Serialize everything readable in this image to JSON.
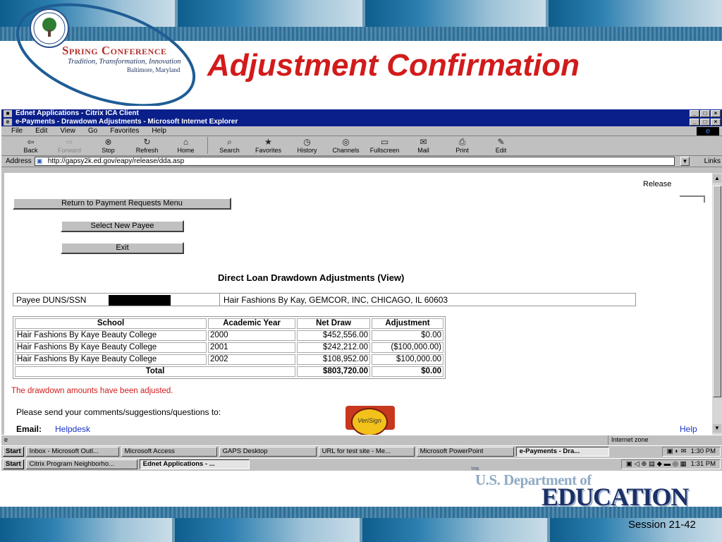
{
  "slide": {
    "conference_name": "Spring Conference",
    "conference_tagline": "Tradition, Transformation, Innovation",
    "conference_location": "Baltimore, Maryland",
    "title": "Adjustment Confirmation",
    "footer_logo_the": "THE",
    "footer_logo_line1": "U.S. Department of",
    "footer_logo_line2": "EDUCATION",
    "session": "Session 21-42"
  },
  "citrix_window": {
    "title": "Ednet Applications - Citrix ICA Client"
  },
  "ie_window": {
    "title": "e-Payments - Drawdown Adjustments - Microsoft Internet Explorer"
  },
  "window_buttons": {
    "minimize": "_",
    "maximize": "□",
    "close": "×"
  },
  "menu": [
    "File",
    "Edit",
    "View",
    "Go",
    "Favorites",
    "Help"
  ],
  "toolbar": [
    {
      "label": "Back",
      "icon": "back-arrow-icon",
      "glyph": "⇦"
    },
    {
      "label": "Forward",
      "icon": "forward-arrow-icon",
      "glyph": "⇨"
    },
    {
      "label": "Stop",
      "icon": "stop-icon",
      "glyph": "⊗"
    },
    {
      "label": "Refresh",
      "icon": "refresh-icon",
      "glyph": "↻"
    },
    {
      "label": "Home",
      "icon": "home-icon",
      "glyph": "⌂"
    },
    {
      "label": "Search",
      "icon": "search-icon",
      "glyph": "⌕"
    },
    {
      "label": "Favorites",
      "icon": "favorites-icon",
      "glyph": "★"
    },
    {
      "label": "History",
      "icon": "history-icon",
      "glyph": "◷"
    },
    {
      "label": "Channels",
      "icon": "channels-icon",
      "glyph": "◎"
    },
    {
      "label": "Fullscreen",
      "icon": "fullscreen-icon",
      "glyph": "▭"
    },
    {
      "label": "Mail",
      "icon": "mail-icon",
      "glyph": "✉"
    },
    {
      "label": "Print",
      "icon": "print-icon",
      "glyph": "⎙"
    },
    {
      "label": "Edit",
      "icon": "edit-icon",
      "glyph": "✎"
    }
  ],
  "address_bar": {
    "label": "Address",
    "url": "http://gapsy2k.ed.gov/eapy/release/dda.asp",
    "links_label": "Links"
  },
  "page": {
    "release_label": "Release",
    "buttons": {
      "return": "Return to Payment Requests Menu",
      "select_payee": "Select New Payee",
      "exit": "Exit"
    },
    "heading": "Direct Loan Drawdown Adjustments (View)",
    "payee_label": "Payee DUNS/SSN",
    "payee_value": "Hair Fashions By Kay, GEMCOR, INC, CHICAGO, IL 60603",
    "table": {
      "headers": [
        "School",
        "Academic Year",
        "Net Draw",
        "Adjustment"
      ],
      "rows": [
        [
          "Hair Fashions By Kaye Beauty College",
          "2000",
          "$452,556.00",
          "$0.00"
        ],
        [
          "Hair Fashions By Kaye Beauty College",
          "2001",
          "$242,212.00",
          "($100,000.00)"
        ],
        [
          "Hair Fashions By Kaye Beauty College",
          "2002",
          "$108,952.00",
          "$100,000.00"
        ]
      ],
      "total_label": "Total",
      "total_net_draw": "$803,720.00",
      "total_adjustment": "$0.00"
    },
    "adjusted_message": "The drawdown amounts have been adjusted.",
    "comments_text": "Please send your comments/suggestions/questions to:",
    "email_label": "Email:",
    "email_link": "Helpdesk",
    "help_link": "Help",
    "seal_text": "VeriSign"
  },
  "status_bar": {
    "zone": "Internet zone"
  },
  "taskbar_inner": {
    "start": "Start",
    "tasks": [
      "Inbox - Microsoft Outl...",
      "Microsoft Access",
      "GAPS Desktop",
      "URL for test site - Me...",
      "Microsoft PowerPoint",
      "e-Payments - Dra..."
    ],
    "clock": "1:30 PM"
  },
  "taskbar_outer": {
    "start": "Start",
    "tasks": [
      "Citrix Program Neighborho...",
      "Ednet Applications - ..."
    ],
    "clock": "1:31 PM"
  },
  "colors": {
    "title_red": "#d21b1b",
    "title_bar_blue": "#0a1f8a",
    "link_blue": "#1a35c8"
  }
}
